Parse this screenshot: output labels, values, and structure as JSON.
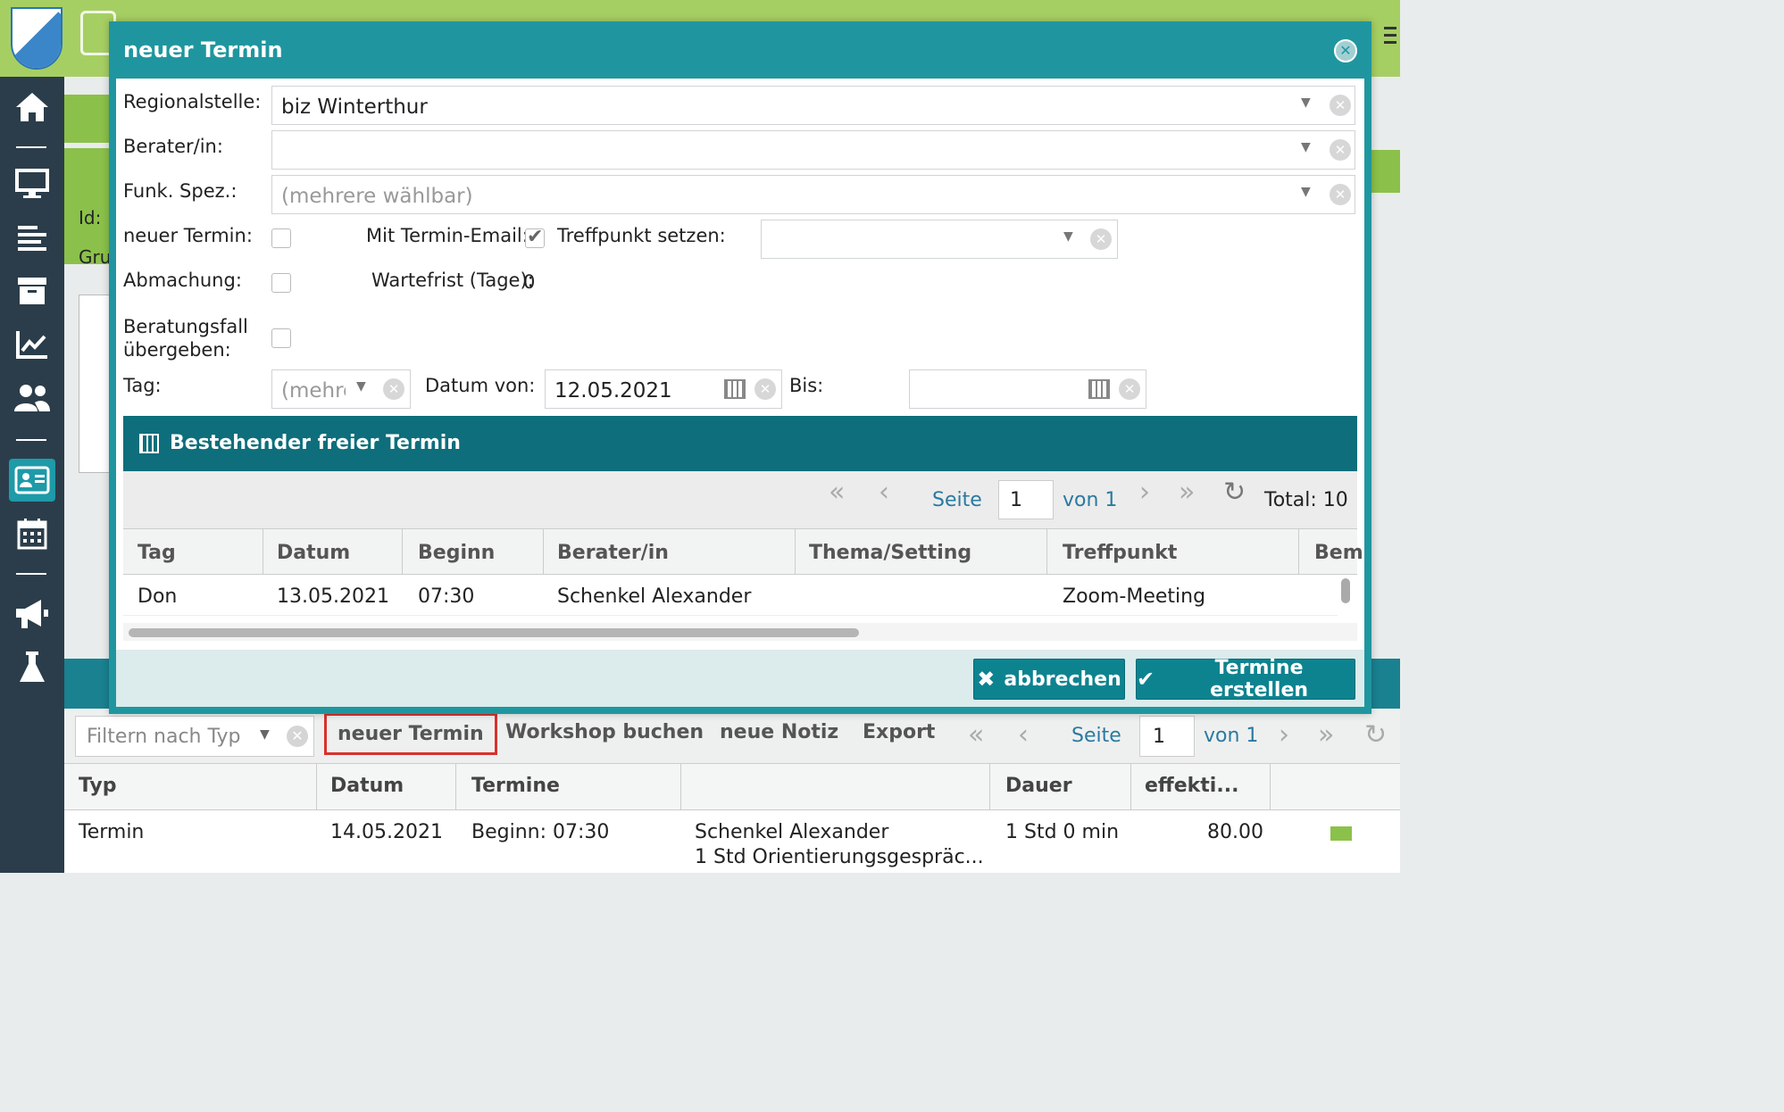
{
  "dialog": {
    "title": "neuer Termin",
    "labels": {
      "regionalstelle": "Regionalstelle:",
      "berater": "Berater/in:",
      "funk_spez": "Funk. Spez.:",
      "neuer_termin": "neuer Termin:",
      "mit_termin_email": "Mit Termin-Email:",
      "treffpunkt": "Treffpunkt setzen:",
      "abmachung": "Abmachung:",
      "wartefrist": "Wartefrist (Tage):",
      "beratungsfall_1": "Beratungsfall",
      "beratungsfall_2": "übergeben:",
      "tag": "Tag:",
      "datum_von": "Datum von:",
      "bis": "Bis:"
    },
    "values": {
      "regionalstelle": "biz Winterthur",
      "berater": "",
      "funk_spez_placeholder": "(mehrere wählbar)",
      "wartefrist": "0",
      "tag_placeholder": "(mehrere wählbar)",
      "datum_von": "12.05.2021",
      "bis": ""
    },
    "checkboxes": {
      "neuer_termin": false,
      "mit_termin_email": true,
      "abmachung": false,
      "beratungsfall": false
    },
    "section": {
      "title": "Bestehender freier Termin",
      "pager": {
        "seite": "Seite",
        "page": "1",
        "von": "von 1",
        "total": "Total: 10"
      },
      "columns": [
        "Tag",
        "Datum",
        "Beginn",
        "Berater/in",
        "Thema/Setting",
        "Treffpunkt",
        "Bem"
      ],
      "rows": [
        {
          "tag": "Don",
          "datum": "13.05.2021",
          "beginn": "07:30",
          "berater": "Schenkel Alexander",
          "thema": "",
          "treffpunkt": "Zoom-Meeting",
          "bem": ""
        }
      ]
    },
    "buttons": {
      "cancel": "abbrechen",
      "create": "Termine erstellen"
    }
  },
  "background": {
    "id_label": "Id:",
    "gru_label": "Gru"
  },
  "bottom": {
    "filter_placeholder": "Filtern nach Typ",
    "toolbar": {
      "neuer_termin": "neuer Termin",
      "workshop": "Workshop buchen",
      "notiz": "neue Notiz",
      "export": "Export"
    },
    "pager": {
      "seite": "Seite",
      "page": "1",
      "von": "von 1"
    },
    "columns": [
      "Typ",
      "Datum",
      "Termine",
      "",
      "Dauer",
      "effekti..."
    ],
    "rows": [
      {
        "typ": "Termin",
        "datum": "14.05.2021",
        "termine": "Beginn: 07:30",
        "person": "Schenkel Alexander",
        "detail": "1 Std Orientierungsgespräc...",
        "dauer": "1 Std 0 min",
        "effektiv": "80.00"
      }
    ]
  },
  "colors": {
    "topbar": "#a6cf63",
    "sidebar": "#2b3d4a",
    "dialog_head": "#1f969f",
    "section_head": "#0e6e7b",
    "button": "#0e8390",
    "highlight": "#d9322a"
  },
  "icons": [
    "home-icon",
    "monitor-icon",
    "list-icon",
    "archive-icon",
    "chart-icon",
    "users-icon",
    "contact-card-icon",
    "calendar-icon",
    "megaphone-icon",
    "flask-icon",
    "search-icon",
    "close-icon",
    "calendar-icon",
    "refresh-icon",
    "mail-icon"
  ]
}
